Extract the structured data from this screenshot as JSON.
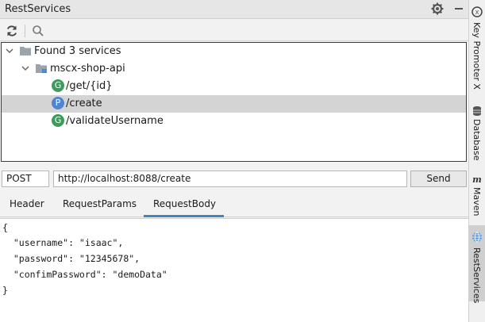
{
  "window": {
    "title": "RestServices"
  },
  "tree": {
    "root_label": "Found 3 services",
    "module_label": "mscx-shop-api",
    "services": [
      {
        "method_badge": "G",
        "path": "/get/{id}"
      },
      {
        "method_badge": "P",
        "path": "/create"
      },
      {
        "method_badge": "G",
        "path": "/validateUsername"
      }
    ]
  },
  "request": {
    "method": "POST",
    "url": "http://localhost:8088/create",
    "send_label": "Send"
  },
  "tabs": {
    "items": [
      "Header",
      "RequestParams",
      "RequestBody"
    ],
    "active": "RequestBody"
  },
  "editor": {
    "lines": [
      "{",
      "  \"username\": \"isaac\",",
      "  \"password\": \"12345678\",",
      "  \"confimPassword\": \"demoData\"",
      "}"
    ]
  },
  "sidebar": {
    "items": [
      {
        "label": "Key Promoter X",
        "icon": "key-promoter-icon"
      },
      {
        "label": "Database",
        "icon": "database-icon"
      },
      {
        "label": "Maven",
        "icon": "maven-icon"
      },
      {
        "label": "RestServices",
        "icon": "rest-services-icon"
      }
    ]
  },
  "colors": {
    "get_badge": "#3d9b5e",
    "post_badge": "#4e86d1",
    "selection": "#d4d4d4",
    "tab_accent": "#4083c9"
  }
}
